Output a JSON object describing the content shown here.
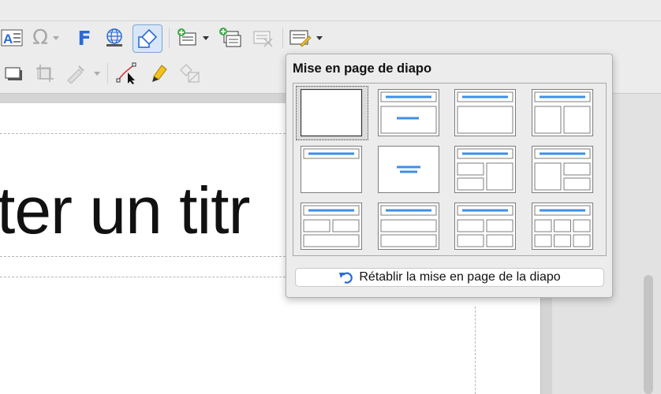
{
  "toolbar": {
    "row1": [
      {
        "name": "fontwork-text-icon",
        "glyph": "A"
      },
      {
        "name": "special-character-icon",
        "glyph": "Ω"
      },
      {
        "name": "fontwork-icon",
        "glyph": "F"
      },
      {
        "name": "hyperlink-globe-icon",
        "glyph": ""
      },
      {
        "name": "shapes-icon",
        "glyph": ""
      },
      {
        "name": "new-slide-icon",
        "glyph": ""
      },
      {
        "name": "duplicate-slide-icon",
        "glyph": ""
      },
      {
        "name": "delete-slide-icon",
        "glyph": ""
      },
      {
        "name": "slide-layout-icon",
        "glyph": ""
      }
    ]
  },
  "slide": {
    "title_text": "ter un titr"
  },
  "popup": {
    "title": "Mise en page de diapo",
    "layouts": [
      {
        "name": "blank"
      },
      {
        "name": "title-subtitle"
      },
      {
        "name": "title-content"
      },
      {
        "name": "title-2-content"
      },
      {
        "name": "title-only"
      },
      {
        "name": "centered-text"
      },
      {
        "name": "title-2-content-content"
      },
      {
        "name": "title-content-2-content"
      },
      {
        "name": "title-2-content-over-content"
      },
      {
        "name": "title-content-over-content"
      },
      {
        "name": "title-4-content"
      },
      {
        "name": "title-6-content"
      }
    ],
    "selected_index": 0,
    "reset_label": "Rétablir la mise en page de la diapo"
  },
  "colors": {
    "accent_blue": "#3d8fe8",
    "layout_border": "#7d7d7d",
    "active_button_bg": "#d8e6f5"
  }
}
